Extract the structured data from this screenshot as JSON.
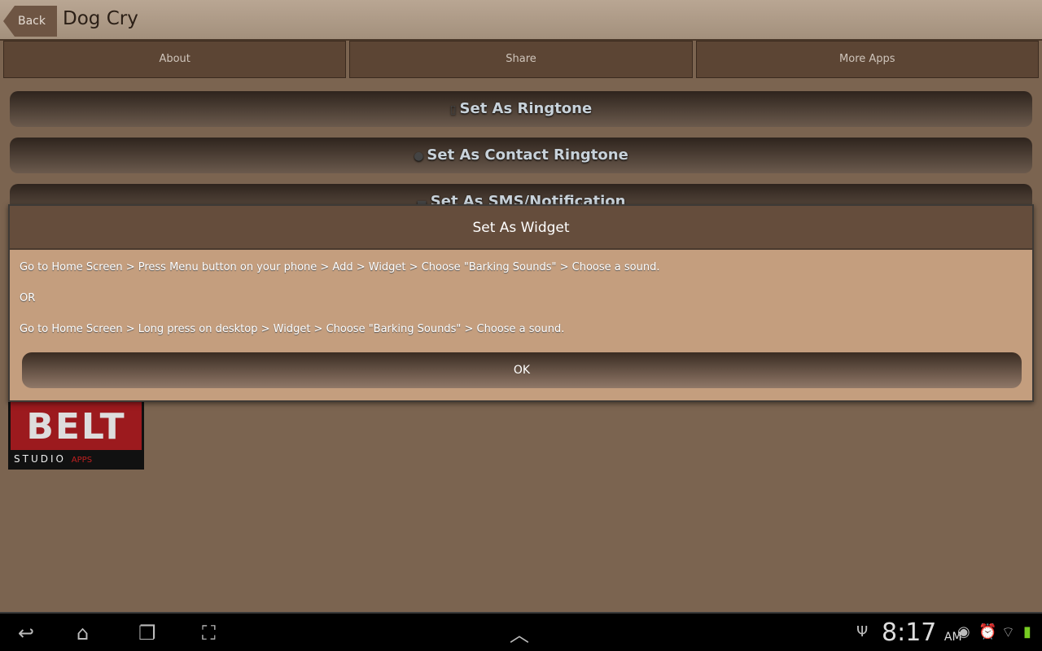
{
  "actionbar": {
    "back": "Back",
    "title": "Dog Cry"
  },
  "tabs": [
    {
      "label": "About"
    },
    {
      "label": "Share"
    },
    {
      "label": "More Apps"
    }
  ],
  "buttons": [
    {
      "label": "Set As Ringtone",
      "icon": "phone-icon"
    },
    {
      "label": "Set As Contact Ringtone",
      "icon": "contact-icon"
    },
    {
      "label": "Set As SMS/Notification",
      "icon": "sms-icon"
    }
  ],
  "logo": {
    "text": "BELT",
    "footer": "STUDIO",
    "apps": "APPS"
  },
  "dialog": {
    "title": "Set As Widget",
    "lines": [
      "Go to Home Screen > Press Menu button on your phone > Add > Widget > Choose \"Barking Sounds\" > Choose a sound.",
      "OR",
      "Go to Home Screen > Long press on desktop > Widget > Choose \"Barking Sounds\" > Choose a sound."
    ],
    "ok": "OK"
  },
  "status": {
    "time": "8:17",
    "ampm": "AM"
  },
  "colors": {
    "accent": "#654d3c",
    "background": "#7b6450",
    "dialog": "#c49e7e"
  }
}
